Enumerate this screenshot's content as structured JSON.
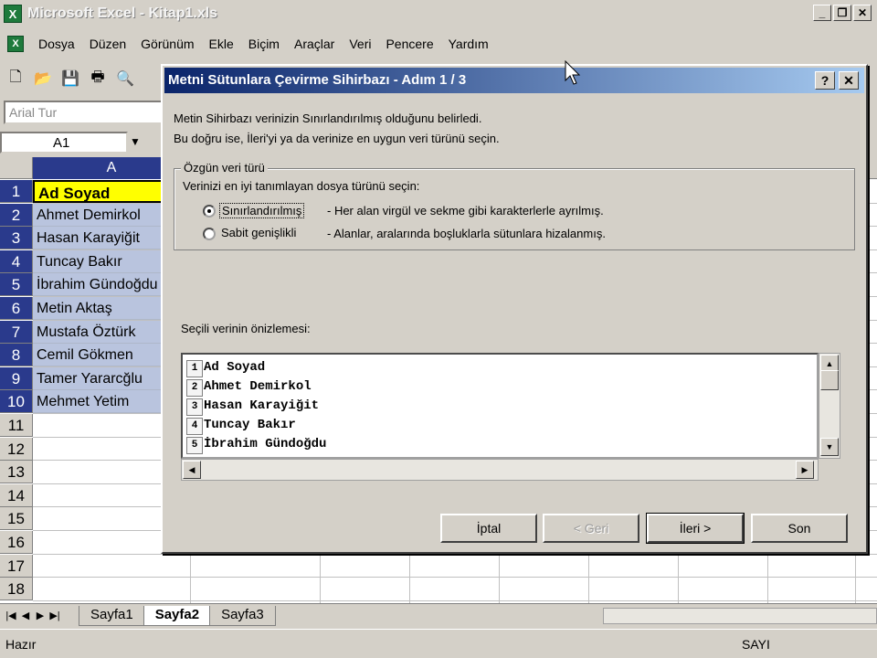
{
  "app": {
    "title": "Microsoft Excel - Kitap1.xls",
    "icon_letter": "X"
  },
  "window_buttons": {
    "minimize": "_",
    "maximize": "❐",
    "close": "✕"
  },
  "menu": [
    "Dosya",
    "Düzen",
    "Görünüm",
    "Ekle",
    "Biçim",
    "Araçlar",
    "Veri",
    "Pencere",
    "Yardım"
  ],
  "toolbar": {
    "font_name": "Arial Tur"
  },
  "namebox": {
    "value": "A1"
  },
  "sheet": {
    "column_header": "A",
    "rows": [
      "1",
      "2",
      "3",
      "4",
      "5",
      "6",
      "7",
      "8",
      "9",
      "10",
      "11",
      "12",
      "13",
      "14",
      "15",
      "16",
      "17",
      "18"
    ],
    "cells": [
      "Ad Soyad",
      "Ahmet Demirkol",
      "Hasan Karayiğit",
      "Tuncay Bakır",
      "İbrahim Gündoğdu",
      "Metin Aktaş",
      "Mustafa Öztürk",
      "Cemil Gökmen",
      "Tamer Yararcğlu",
      "Mehmet Yetim"
    ]
  },
  "sheet_tabs": [
    "Sayfa1",
    "Sayfa2",
    "Sayfa3"
  ],
  "status": {
    "left": "Hazır",
    "right": "SAYI"
  },
  "dialog": {
    "title": "Metni Sütunlara Çevirme Sihirbazı - Adım 1 / 3",
    "help_btn": "?",
    "close_btn": "✕",
    "intro_line1": "Metin Sihirbazı verinizin Sınırlandırılmış olduğunu belirledi.",
    "intro_line2": "Bu doğru ise, İleri'yi ya da verinize en uygun veri türünü seçin.",
    "group_label": "Özgün veri türü",
    "group_prompt": "Verinizi en iyi tanımlayan dosya türünü seçin:",
    "option1_label": "Sınırlandırılmış",
    "option1_desc": "- Her alan virgül ve sekme gibi karakterlerle ayrılmış.",
    "option2_label": "Sabit genişlikli",
    "option2_desc": "- Alanlar, aralarında boşluklarla sütunlara hizalanmış.",
    "preview_label": "Seçili verinin önizlemesi:",
    "preview_rows": [
      {
        "num": "1",
        "text": "Ad Soyad"
      },
      {
        "num": "2",
        "text": "Ahmet Demirkol"
      },
      {
        "num": "3",
        "text": "Hasan Karayiğit"
      },
      {
        "num": "4",
        "text": "Tuncay Bakır"
      },
      {
        "num": "5",
        "text": "İbrahim Gündoğdu"
      }
    ],
    "buttons": {
      "cancel": "İptal",
      "back": "< Geri",
      "next": "İleri >",
      "finish": "Son"
    }
  }
}
